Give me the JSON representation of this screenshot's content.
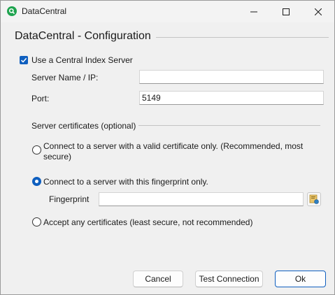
{
  "window": {
    "title": "DataCentral",
    "accent_color": "#0f5fbf",
    "app_icon_color": "#1fa44f"
  },
  "heading": "DataCentral - Configuration",
  "central_index": {
    "label": "Use a Central Index Server",
    "checked": true
  },
  "server": {
    "name_label": "Server Name / IP:",
    "name_value": "",
    "port_label": "Port:",
    "port_value": "5149"
  },
  "certificates": {
    "group_label": "Server certificates (optional)",
    "option_valid_line1": "Connect to a server with a valid certificate only. (Recommended, most",
    "option_valid_line2": "secure)",
    "option_fingerprint": "Connect to a server with this fingerprint only.",
    "option_any": "Accept any certificates (least secure, not recommended)",
    "selected": "fingerprint",
    "fingerprint_label": "Fingerprint",
    "fingerprint_value": ""
  },
  "buttons": {
    "cancel": "Cancel",
    "test": "Test Connection",
    "ok": "Ok"
  }
}
